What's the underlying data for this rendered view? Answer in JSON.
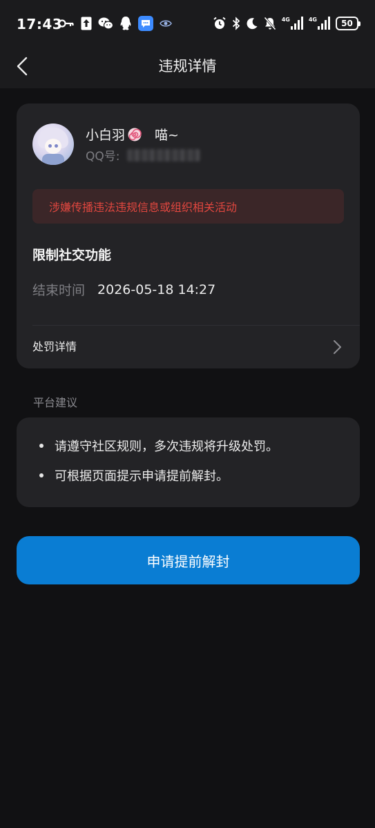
{
  "status_bar": {
    "time": "17:43",
    "left_icons": [
      "key-icon",
      "upload-arrow-icon",
      "wechat-icon",
      "qq-penguin-icon",
      "chat-bubble-icon",
      "eye-icon"
    ],
    "right_icons": [
      "alarm-icon",
      "bluetooth-icon",
      "moon-icon",
      "bell-off-icon",
      "signal-4g-icon",
      "signal-4g-icon"
    ],
    "network_label_1": "4G",
    "network_label_2": "4G",
    "battery": "50"
  },
  "nav": {
    "title": "违规详情",
    "back_icon": "chevron-left-icon"
  },
  "violation": {
    "nickname": "小白羽",
    "nickname_icon": "lollipop-icon",
    "nickname_suffix": "喵~",
    "qq_label": "QQ号:",
    "alert": "涉嫌传播违法违规信息或组织相关活动",
    "restriction": "限制社交功能",
    "end_time_label": "结束时间",
    "end_time_value": "2026-05-18 14:27",
    "penalty_details_label": "处罚详情"
  },
  "advice": {
    "heading": "平台建议",
    "items": [
      "请遵守社区规则，多次违规将升级处罚。",
      "可根据页面提示申请提前解封。"
    ]
  },
  "appeal_button": {
    "label": "申请提前解封"
  },
  "colors": {
    "page_bg": "#111113",
    "bar_bg": "#1B1B1D",
    "card_bg": "#232326",
    "alert_bg": "#3B2628",
    "alert_text": "#E1473F",
    "primary_button": "#0A7DD3"
  }
}
